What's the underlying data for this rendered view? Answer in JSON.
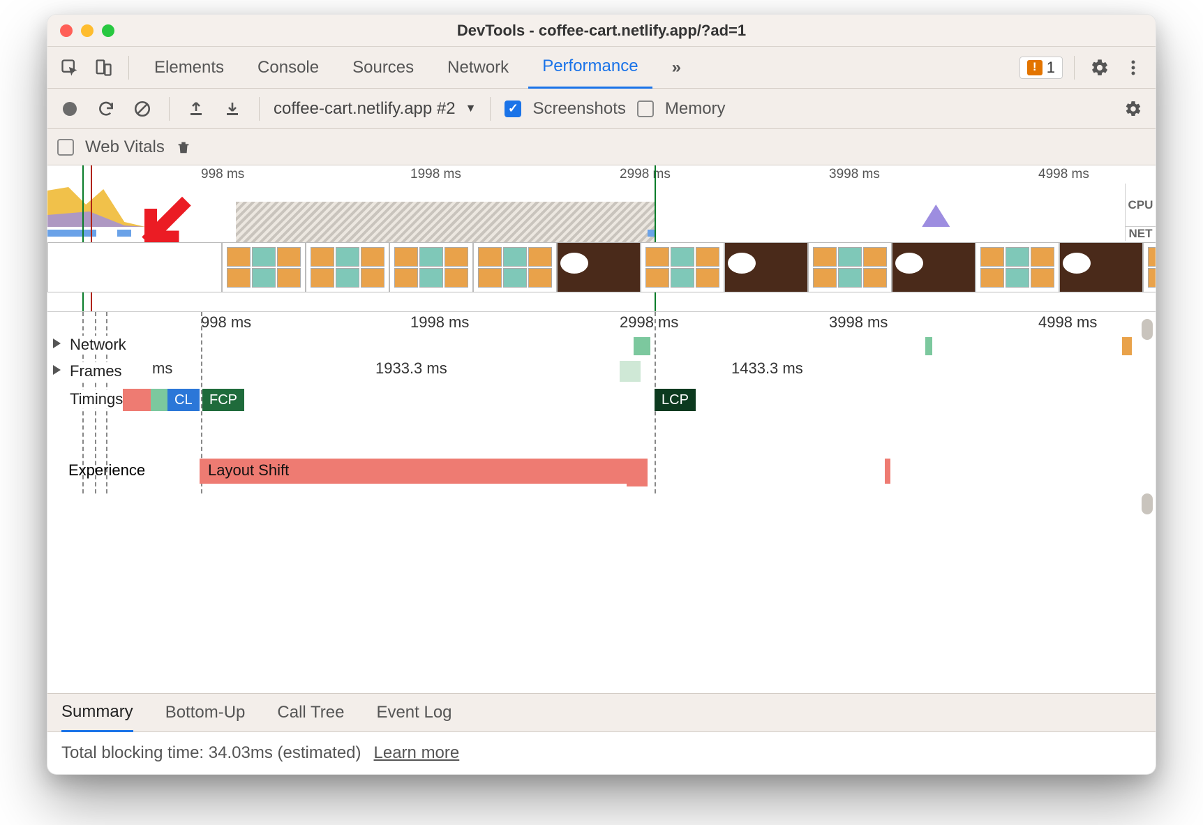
{
  "window": {
    "title": "DevTools - coffee-cart.netlify.app/?ad=1"
  },
  "panel_tabs": {
    "items": [
      "Elements",
      "Console",
      "Sources",
      "Network",
      "Performance"
    ],
    "active": "Performance",
    "more_glyph": "»",
    "issues_count": "1"
  },
  "perf_toolbar": {
    "profile_selector": "coffee-cart.netlify.app #2",
    "screenshots_label": "Screenshots",
    "screenshots_checked": true,
    "memory_label": "Memory",
    "memory_checked": false
  },
  "perf_toolbar2": {
    "web_vitals_label": "Web Vitals",
    "web_vitals_checked": false
  },
  "overview": {
    "ticks": [
      "998 ms",
      "1998 ms",
      "2998 ms",
      "3998 ms",
      "4998 ms"
    ],
    "lane_labels": {
      "cpu": "CPU",
      "net": "NET"
    }
  },
  "flame": {
    "ruler_ticks": [
      "998 ms",
      "1998 ms",
      "2998 ms",
      "3998 ms",
      "4998 ms"
    ],
    "tracks": {
      "network": "Network",
      "frames": "Frames",
      "timings": "Timings",
      "experience": "Experience"
    },
    "frames_durations": [
      "ms",
      "1933.3 ms",
      "1433.3 ms"
    ],
    "timings_badges": {
      "cl": "CL",
      "fcp": "FCP",
      "lcp": "LCP"
    },
    "experience_bar_label": "Layout Shift"
  },
  "detail_tabs": {
    "items": [
      "Summary",
      "Bottom-Up",
      "Call Tree",
      "Event Log"
    ],
    "active": "Summary"
  },
  "summary": {
    "tbt_text": "Total blocking time: 34.03ms (estimated)",
    "learn_more": "Learn more"
  }
}
